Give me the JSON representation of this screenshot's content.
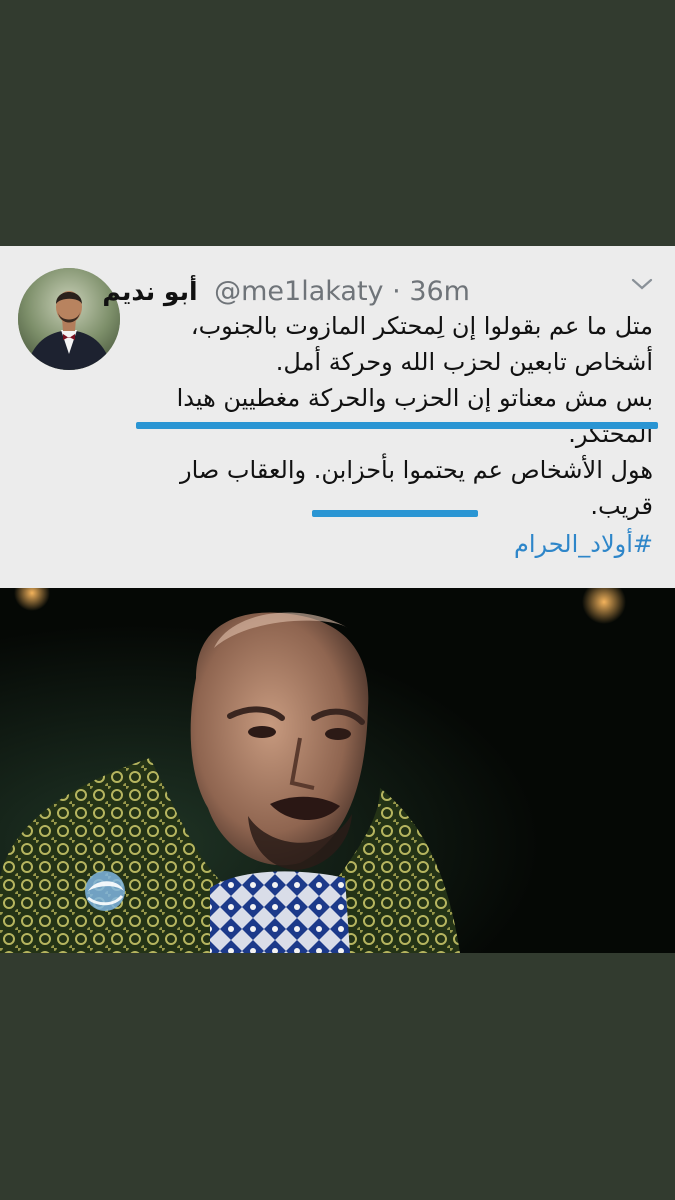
{
  "tweet": {
    "author_name": "أبو نديم",
    "handle": "@me1lakaty",
    "separator": "·",
    "time": "36m",
    "lines": [
      "متل ما عم بقولوا إن لِمحتكر المازوت بالجنوب،",
      "أشخاص تابعين لحزب الله وحركة أمل.",
      "بس مش معناتو إن الحزب والحركة مغطيين هيدا",
      "المحتكر.",
      "هول الأشخاص عم يحتموا بأحزابن. والعقاب صار",
      "قريب."
    ],
    "hashtag": "#أولاد_الحرام"
  },
  "icons": {
    "menu": "chevron-down-icon",
    "channel_logo": "channel-logo-icon"
  },
  "colors": {
    "page_background": "#323b2f",
    "card_background": "#ececec",
    "highlight": "#2a95d3",
    "hashtag": "#2e86c9"
  }
}
